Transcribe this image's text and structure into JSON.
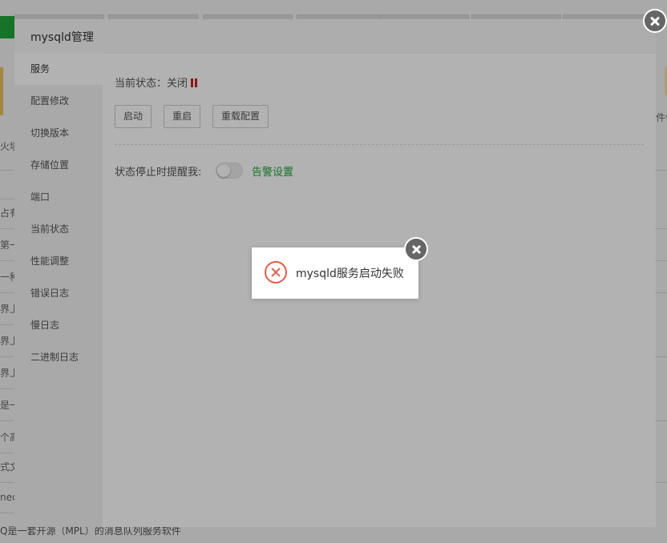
{
  "background": {
    "left_fragments": [
      "火墙",
      "占有",
      "第一",
      "一种",
      "界上",
      "界上",
      "界上",
      "是一",
      "个高",
      "式文",
      "ned"
    ],
    "right_fragment": "件传",
    "bottom_text": "Q是一套开源（MPL）的消息队列服务软件"
  },
  "dialog": {
    "title": "mysqld管理",
    "sidebar_items": [
      {
        "label": "服务"
      },
      {
        "label": "配置修改"
      },
      {
        "label": "切换版本"
      },
      {
        "label": "存储位置"
      },
      {
        "label": "端口"
      },
      {
        "label": "当前状态"
      },
      {
        "label": "性能调整"
      },
      {
        "label": "错误日志"
      },
      {
        "label": "慢日志"
      },
      {
        "label": "二进制日志"
      }
    ],
    "status_label": "当前状态：",
    "status_value": "关闭",
    "buttons": {
      "start": "启动",
      "restart": "重启",
      "reload": "重载配置"
    },
    "remind_label": "状态停止时提醒我:",
    "remind_enabled": false,
    "alert_settings": "告警设置"
  },
  "toast": {
    "message": "mysqld服务启动失败",
    "icon": "error-icon"
  },
  "colors": {
    "accent_green": "#20a53a",
    "status_red": "#cc2222",
    "error_red": "#e35a4a"
  }
}
